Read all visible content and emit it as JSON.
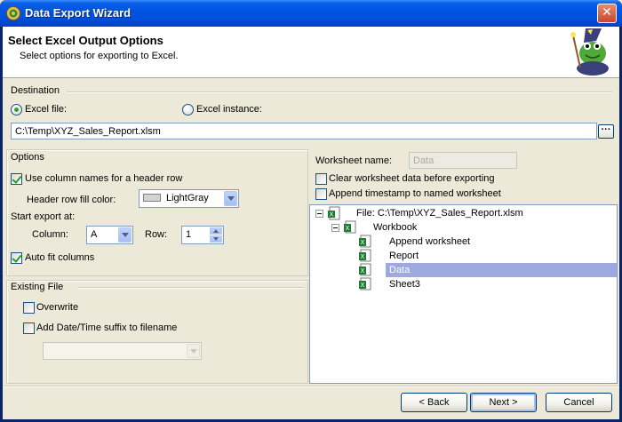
{
  "window": {
    "title": "Data Export Wizard",
    "close_symbol": "✕"
  },
  "header": {
    "title": "Select Excel Output Options",
    "subtitle": "Select options for exporting to Excel."
  },
  "destination": {
    "group_label": "Destination",
    "excel_file_label": "Excel file:",
    "excel_file_selected": true,
    "excel_instance_label": "Excel instance:",
    "excel_instance_selected": false,
    "file_path": "C:\\Temp\\XYZ_Sales_Report.xlsm",
    "browse_label": "···"
  },
  "options": {
    "group_label": "Options",
    "use_header_label": "Use column names for a header row",
    "use_header_checked": true,
    "fill_color_label": "Header row fill color:",
    "fill_color_value": "LightGray",
    "fill_color_hex": "#D3D3D3",
    "start_export_label": "Start export at:",
    "column_label": "Column:",
    "column_value": "A",
    "row_label": "Row:",
    "row_value": "1",
    "autofit_label": "Auto fit columns",
    "autofit_checked": true
  },
  "existing_file": {
    "group_label": "Existing File",
    "overwrite_label": "Overwrite",
    "overwrite_checked": false,
    "suffix_label": "Add Date/Time suffix to filename",
    "suffix_checked": false,
    "suffix_format_value": ""
  },
  "worksheet": {
    "name_label": "Worksheet name:",
    "name_value": "Data",
    "clear_label": "Clear worksheet data before exporting",
    "clear_checked": false,
    "timestamp_label": "Append timestamp to named worksheet",
    "timestamp_checked": false
  },
  "tree": {
    "file_label": "File: C:\\Temp\\XYZ_Sales_Report.xlsm",
    "workbook_label": "Workbook",
    "sheets": [
      {
        "label": "Append worksheet",
        "selected": false
      },
      {
        "label": "Report",
        "selected": false
      },
      {
        "label": "Data",
        "selected": true
      },
      {
        "label": "Sheet3",
        "selected": false
      }
    ]
  },
  "footer": {
    "back_label": "< Back",
    "next_label": "Next >",
    "cancel_label": "Cancel"
  },
  "colors": {
    "title_bar": "#0054E3",
    "selection": "#9EA9E0",
    "check_mark": "#21A121"
  },
  "icons": {
    "app": "gear-globe-icon",
    "mascot": "wizard-frog-icon",
    "file_node": "excel-file-icon",
    "workbook_node": "excel-workbook-icon",
    "sheet_node": "excel-sheet-icon"
  }
}
